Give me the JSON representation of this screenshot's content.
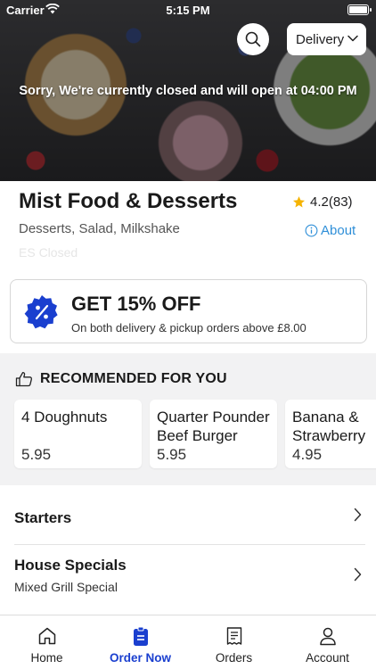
{
  "status_bar": {
    "carrier": "Carrier",
    "time": "5:15 PM"
  },
  "header": {
    "search_icon": "search-icon",
    "order_mode": "Delivery",
    "closed_message": "Sorry, We're currently closed and will open at 04:00 PM"
  },
  "restaurant": {
    "name": "Mist Food & Desserts",
    "rating": "4.2(83)",
    "cuisines": "Desserts, Salad, Milkshake",
    "about_label": "About",
    "status": "ES Closed"
  },
  "offer": {
    "title": "GET 15% OFF",
    "subtitle": "On both delivery & pickup orders above £8.00"
  },
  "recommended": {
    "heading": "RECOMMENDED FOR YOU",
    "items": [
      {
        "name": "4 Doughnuts",
        "price": "5.95"
      },
      {
        "name": "Quarter Pounder Beef Burger",
        "price": "5.95"
      },
      {
        "name": "Banana & Strawberry",
        "price": "4.95"
      }
    ]
  },
  "categories": [
    {
      "title": "Starters",
      "subtitle": ""
    },
    {
      "title": "House Specials",
      "subtitle": "Mixed Grill Special"
    }
  ],
  "tabbar": {
    "items": [
      {
        "label": "Home",
        "icon": "home-icon",
        "active": false
      },
      {
        "label": "Order Now",
        "icon": "order-now-icon",
        "active": true
      },
      {
        "label": "Orders",
        "icon": "receipt-icon",
        "active": false
      },
      {
        "label": "Account",
        "icon": "account-icon",
        "active": false
      }
    ]
  },
  "colors": {
    "accent": "#1a3fcf",
    "link": "#2f8fd8",
    "star": "#f5b301"
  }
}
